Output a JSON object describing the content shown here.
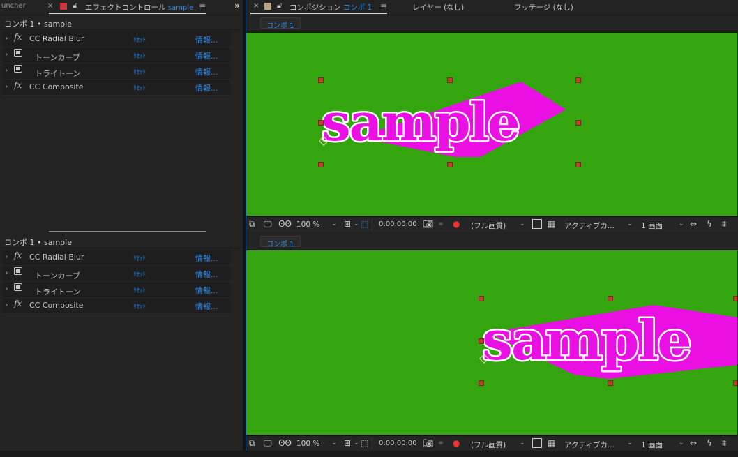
{
  "left": {
    "launcher_tab": "uncher",
    "effect_tab_label": "エフェクトコントロール",
    "effect_tab_layer": "sample",
    "close_glyph": "×",
    "menu_glyph": "≡",
    "overflow_glyph": "»",
    "header": "コンポ 1 • sample",
    "effects": [
      {
        "name": "CC Radial Blur",
        "icon": "fx-icon",
        "reset": "ﾘｾｯﾄ",
        "about": "情報..."
      },
      {
        "name": "トーンカーブ",
        "icon": "preset-icon",
        "reset": "ﾘｾｯﾄ",
        "about": "情報..."
      },
      {
        "name": "トライトーン",
        "icon": "preset-icon",
        "reset": "ﾘｾｯﾄ",
        "about": "情報..."
      },
      {
        "name": "CC Composite",
        "icon": "fx-icon",
        "reset": "ﾘｾｯﾄ",
        "about": "情報..."
      }
    ],
    "fx_glyph": "fx"
  },
  "right": {
    "comp_tab_label": "コンポジション",
    "comp_tab_name": "コンポ 1",
    "layer_tab": "レイヤー (なし)",
    "footage_tab": "フッテージ (なし)",
    "comp_chip": "コンポ 1",
    "canvas_text": "sample",
    "toolbar": {
      "zoom": "100 %",
      "timecode": "0:00:00:00",
      "resolution": "(フル画質)",
      "camera": "アクティブカ...",
      "views": "1 画面"
    }
  },
  "colors": {
    "canvas_bg": "#34a50e",
    "text_fill": "#ea0fe3",
    "text_stroke": "#ffffff",
    "accent": "#2d8ceb",
    "handle": "#b8432d"
  }
}
